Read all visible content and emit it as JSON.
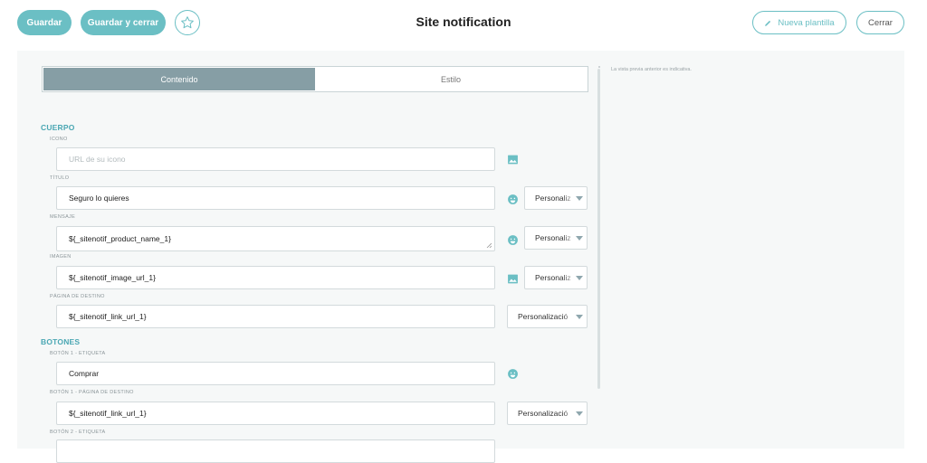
{
  "toolbar": {
    "save_label": "Guardar",
    "save_close_label": "Guardar y cerrar",
    "title": "Site notification",
    "new_template_label": "Nueva plantilla",
    "close_label": "Cerrar"
  },
  "tabs": [
    {
      "label": "Contenido",
      "active": true
    },
    {
      "label": "Estilo",
      "active": false
    }
  ],
  "preview_note": "La vista previa anterior es indicativa.",
  "sections": {
    "body_title": "CUERPO",
    "buttons_title": "BOTONES"
  },
  "fields": {
    "icon": {
      "label": "ICONO",
      "value": "",
      "placeholder": "URL de su icono"
    },
    "title": {
      "label": "TÍTULO",
      "value": "Seguro lo quieres",
      "select": "Personaliz"
    },
    "message": {
      "label": "MENSAJE",
      "value": "${_sitenotif_product_name_1}",
      "select": "Personaliz"
    },
    "image": {
      "label": "IMAGEN",
      "value": "${_sitenotif_image_url_1}",
      "select": "Personaliz"
    },
    "landing": {
      "label": "PÁGINA DE DESTINO",
      "value": "${_sitenotif_link_url_1}",
      "select": "Personalizació"
    },
    "btn1_label": {
      "label": "BOTÓN 1 - ETIQUETA",
      "value": "Comprar"
    },
    "btn1_landing": {
      "label": "BOTÓN 1 - PÁGINA DE DESTINO",
      "value": "${_sitenotif_link_url_1}",
      "select": "Personalizació"
    },
    "btn2_label": {
      "label": "BOTÓN 2 - ETIQUETA"
    }
  },
  "colors": {
    "accent": "#6bbfc4",
    "tab_active": "#869ea5",
    "section_title": "#4aa7b3"
  },
  "icons": [
    "star-icon",
    "pencil-icon",
    "image-icon",
    "emoji-icon",
    "caret-down-icon"
  ]
}
